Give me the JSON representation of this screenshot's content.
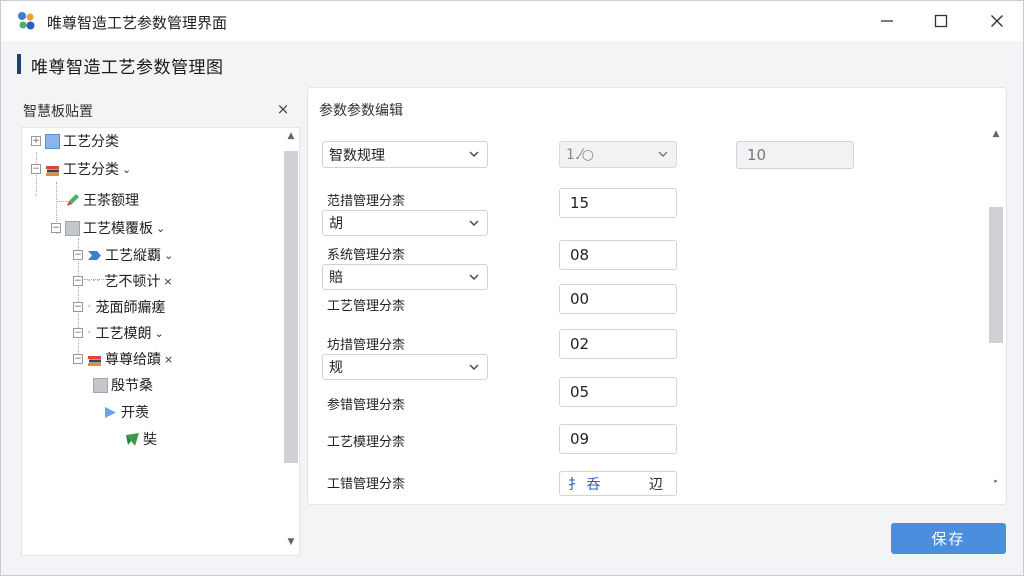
{
  "window": {
    "title": "唯尊智造工艺参数管理界面"
  },
  "page": {
    "title": "唯尊智造工艺参数管理图"
  },
  "left_panel": {
    "header": "智慧板贴置",
    "close_glyph": "×",
    "tree": [
      {
        "label": "工艺分类",
        "icon": "blue-square-icon"
      },
      {
        "label": "工艺分类",
        "icon": "books-icon",
        "chevron": "⌄"
      },
      {
        "label": "王茶额理",
        "icon": "pencil-icon"
      },
      {
        "label": "工艺模覆板",
        "icon": "gray-square-icon",
        "chevron": "⌄"
      },
      {
        "label": "工艺縦覇",
        "icon": "arrow-icon",
        "chevron": "⌄"
      },
      {
        "label": "艺不顿计",
        "icon": "",
        "chevron": "×"
      },
      {
        "label": "茏面師瘺瘥",
        "icon": ""
      },
      {
        "label": "工艺模朗",
        "icon": "",
        "chevron": "⌄"
      },
      {
        "label": "尊尊给蹟",
        "icon": "books-icon",
        "chevron": "×"
      },
      {
        "label": "殷节桑",
        "icon": "gray-square-icon"
      },
      {
        "label": "开羡",
        "icon": "triangle-icon"
      },
      {
        "label": "奘",
        "icon": "leaf-icon"
      }
    ]
  },
  "right_panel": {
    "header": "参数参数编辑",
    "top_select": {
      "value": "智数规理"
    },
    "mid_select": {
      "value": "1.⁄○"
    },
    "top_readonly": {
      "value": "10"
    },
    "fields": [
      {
        "label": "范措管理分柰",
        "select_value": "胡",
        "input_value": "15"
      },
      {
        "label": "系统管理分柰",
        "select_value": "賠",
        "input_value": "08"
      },
      {
        "label": "工艺管理分柰",
        "input_value": "00"
      },
      {
        "label": "坊措管理分柰",
        "select_value": "规",
        "input_value": "02"
      },
      {
        "label": "参错管理分柰",
        "input_value": "05"
      },
      {
        "label": "工艺模理分柰",
        "input_value": "09"
      },
      {
        "label": "工错管理分柰",
        "input_value_left": "扌 呑",
        "input_value_right": "辺"
      }
    ]
  },
  "actions": {
    "save_label": "保存"
  },
  "colors": {
    "accent": "#4a8fde",
    "title_bar_accent": "#1f3f77"
  }
}
